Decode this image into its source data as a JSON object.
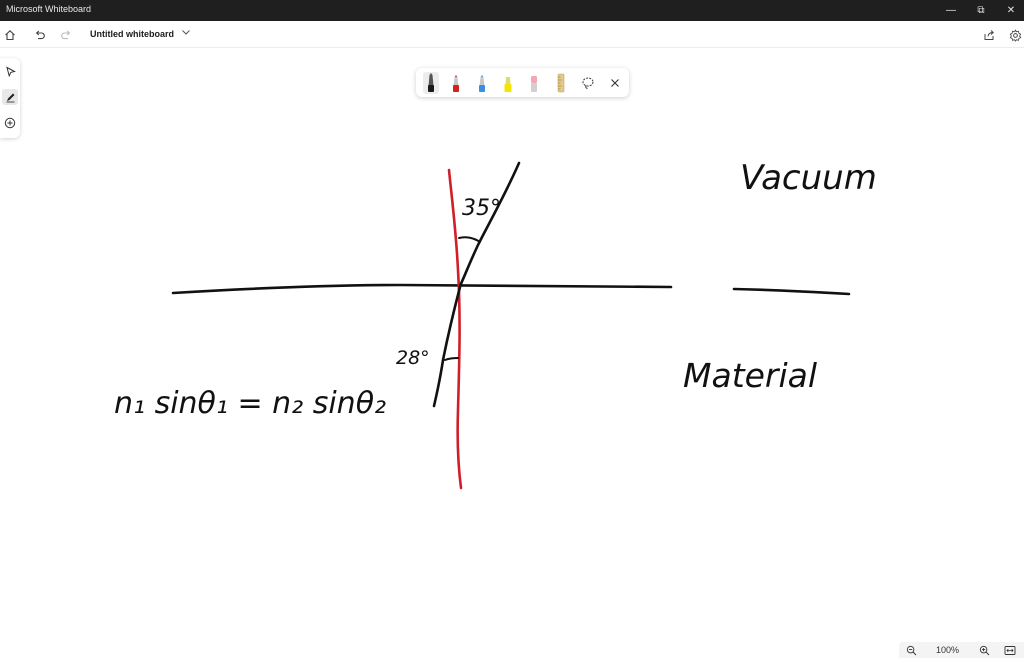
{
  "window": {
    "app_title": "Microsoft Whiteboard",
    "controls": {
      "minimize": "—",
      "restore": "⧉",
      "close": "✕"
    }
  },
  "toolbar": {
    "board_title": "Untitled whiteboard",
    "icons": [
      "home-icon",
      "undo-icon",
      "redo-icon",
      "chevron-down-icon",
      "share-icon",
      "settings-icon"
    ]
  },
  "left_tools": [
    "select-icon",
    "pen-icon",
    "add-icon"
  ],
  "ink_tray": {
    "pens": [
      {
        "name": "black-pen",
        "color": "#1a1a1a"
      },
      {
        "name": "red-pen",
        "color": "#d42020"
      },
      {
        "name": "blue-pen",
        "color": "#3c8ee0"
      },
      {
        "name": "yellow-highlighter",
        "color": "#f2e600"
      },
      {
        "name": "eraser",
        "color": "#f2a7b5"
      },
      {
        "name": "ruler",
        "color": "#e3c98a"
      }
    ],
    "icons": [
      "lasso-icon",
      "close-icon"
    ],
    "selected": "black-pen"
  },
  "canvas": {
    "annotations": {
      "top_medium": "Vacuum",
      "bottom_medium": "Material",
      "angle_top": "35°",
      "angle_bottom": "28°",
      "equation": "n₁ sinθ₁ = n₂ sinθ₂"
    },
    "ink_colors": {
      "black": "#111111",
      "red": "#d11f2a"
    }
  },
  "zoom": {
    "level": "100%",
    "icons": [
      "zoom-out-icon",
      "zoom-in-icon",
      "fit-to-screen-icon"
    ]
  }
}
